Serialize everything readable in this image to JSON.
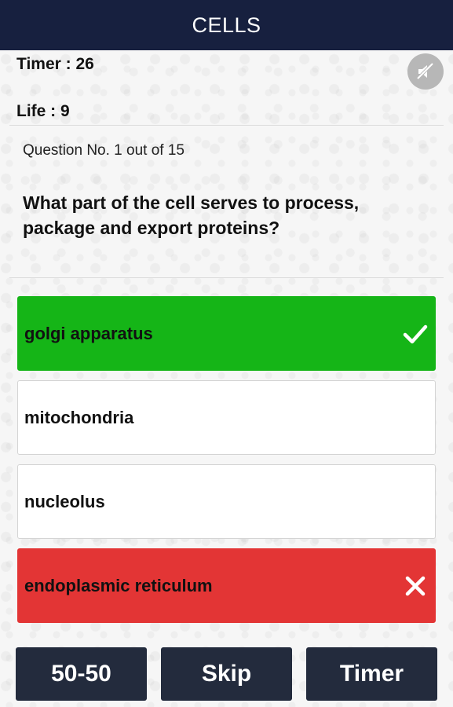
{
  "header": {
    "title": "CELLS"
  },
  "stats": {
    "timer_label": "Timer  : 26",
    "life_label": "Life : 9",
    "sound_icon": "sound-off-icon"
  },
  "question": {
    "number_text": "Question No. 1 out of 15",
    "text": "What part of the cell serves to process, package and export proteins?"
  },
  "options": [
    {
      "label": "golgi apparatus",
      "state": "correct",
      "color": "#15b517",
      "icon": "check-icon"
    },
    {
      "label": "mitochondria",
      "state": "neutral",
      "color": "#ffffff"
    },
    {
      "label": "nucleolus",
      "state": "neutral",
      "color": "#ffffff"
    },
    {
      "label": "endoplasmic reticulum",
      "state": "wrong",
      "color": "#e33535",
      "icon": "cross-icon"
    }
  ],
  "actions": {
    "fifty_fifty": "50-50",
    "skip": "Skip",
    "timer": "Timer"
  },
  "colors": {
    "header_bg": "#17203f",
    "button_bg": "#232b3d",
    "correct": "#15b517",
    "wrong": "#e33535"
  }
}
